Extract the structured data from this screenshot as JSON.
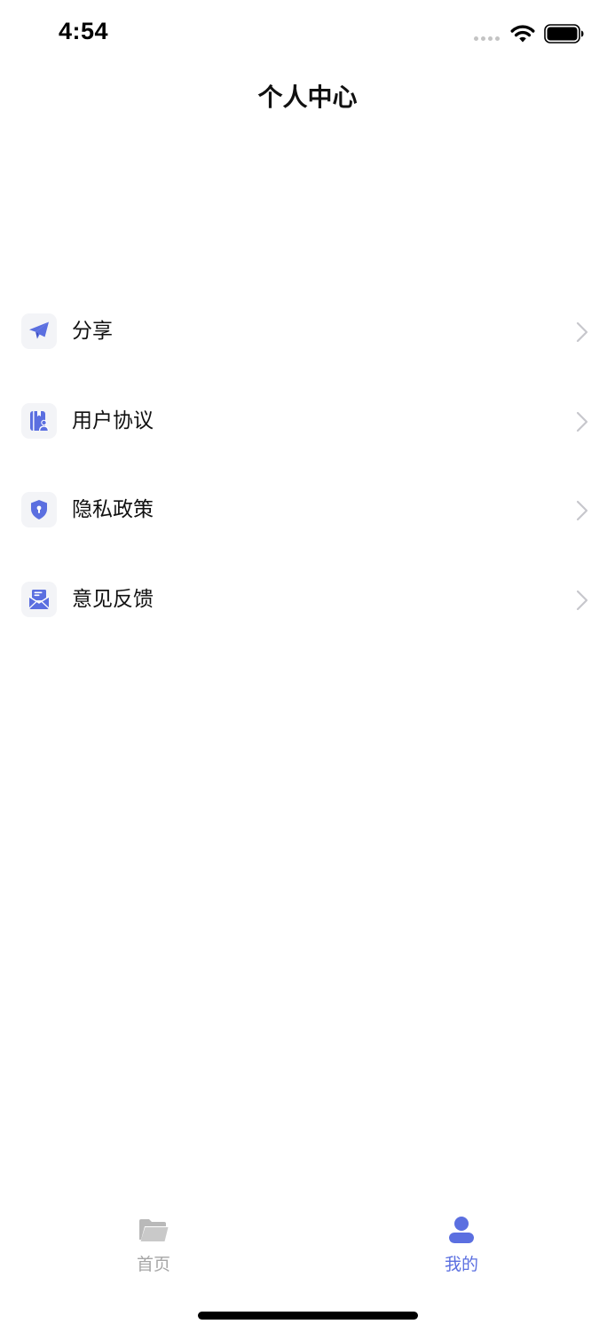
{
  "status_bar": {
    "time": "4:54"
  },
  "header": {
    "title": "个人中心"
  },
  "menu": {
    "items": [
      {
        "label": "分享",
        "icon": "paper-plane-icon"
      },
      {
        "label": "用户协议",
        "icon": "user-agreement-icon"
      },
      {
        "label": "隐私政策",
        "icon": "shield-icon"
      },
      {
        "label": "意见反馈",
        "icon": "envelope-icon"
      }
    ]
  },
  "tab_bar": {
    "tabs": [
      {
        "label": "首页",
        "icon": "folder-icon",
        "active": false
      },
      {
        "label": "我的",
        "icon": "user-icon",
        "active": true
      }
    ]
  },
  "colors": {
    "accent": "#5b6fe0",
    "inactive": "#a6a6a6",
    "icon_bg": "#f3f4f7",
    "chevron": "#c7c7cc"
  }
}
